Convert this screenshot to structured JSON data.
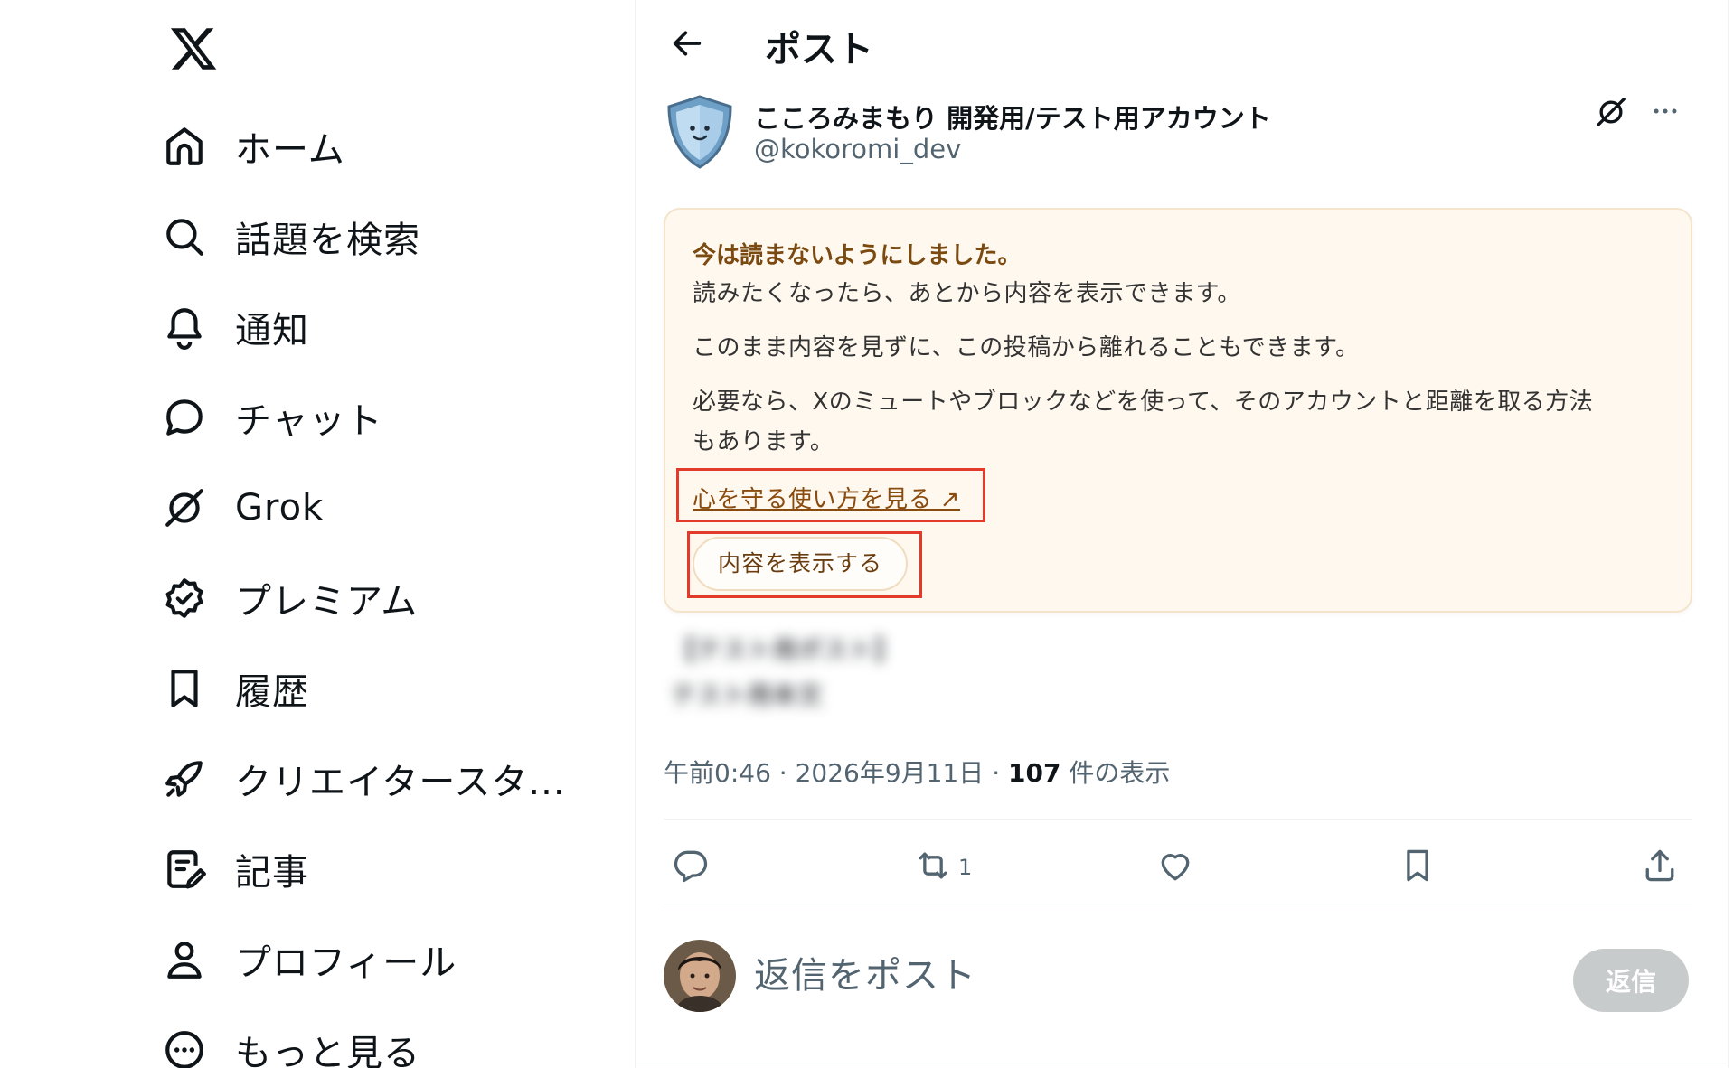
{
  "sidebar": {
    "logo_icon": "x-logo-icon",
    "items": [
      {
        "label": "ホーム",
        "icon": "home-icon"
      },
      {
        "label": "話題を検索",
        "icon": "search-icon"
      },
      {
        "label": "通知",
        "icon": "bell-icon"
      },
      {
        "label": "チャット",
        "icon": "chat-bubble-icon"
      },
      {
        "label": "Grok",
        "icon": "grok-icon"
      },
      {
        "label": "プレミアム",
        "icon": "verified-badge-icon"
      },
      {
        "label": "履歴",
        "icon": "bookmark-icon"
      },
      {
        "label": "クリエイタースタ...",
        "icon": "rocket-icon"
      },
      {
        "label": "記事",
        "icon": "article-icon"
      },
      {
        "label": "プロフィール",
        "icon": "person-icon"
      },
      {
        "label": "もっと見る",
        "icon": "more-circle-icon"
      }
    ]
  },
  "header": {
    "title": "ポスト",
    "back_icon": "arrow-left-icon"
  },
  "post": {
    "author_name": "こころみまもり 開発用/テスト用アカウント",
    "author_handle": "@kokoromi_dev",
    "blurred_line_1": "【テスト用ポスト】",
    "blurred_line_2": "テスト用本文",
    "time": "午前0:46",
    "date": "2026年9月11日",
    "sep": "·",
    "views_count": "107",
    "views_label": "件の表示",
    "retweet_count": "1"
  },
  "notice": {
    "title": "今は読まないようにしました。",
    "line1": "読みたくなったら、あとから内容を表示できます。",
    "line2": "このまま内容を見ずに、この投稿から離れることもできます。",
    "line3a": "必要なら、Xのミュートやブロックなどを使って、そのアカウントと距離を取る方法",
    "line3b": "もあります。",
    "link_label": "心を守る使い方を見る ↗",
    "show_button_label": "内容を表示する",
    "colors": {
      "background": "#fff8ef",
      "title": "#7a4a10",
      "highlight_box": "#e23a2b"
    }
  },
  "reply": {
    "placeholder": "返信をポスト",
    "button_label": "返信"
  },
  "colors": {
    "text_primary": "#0f1419",
    "text_secondary": "#536471",
    "reply_button_disabled": "#c8cbcc"
  }
}
